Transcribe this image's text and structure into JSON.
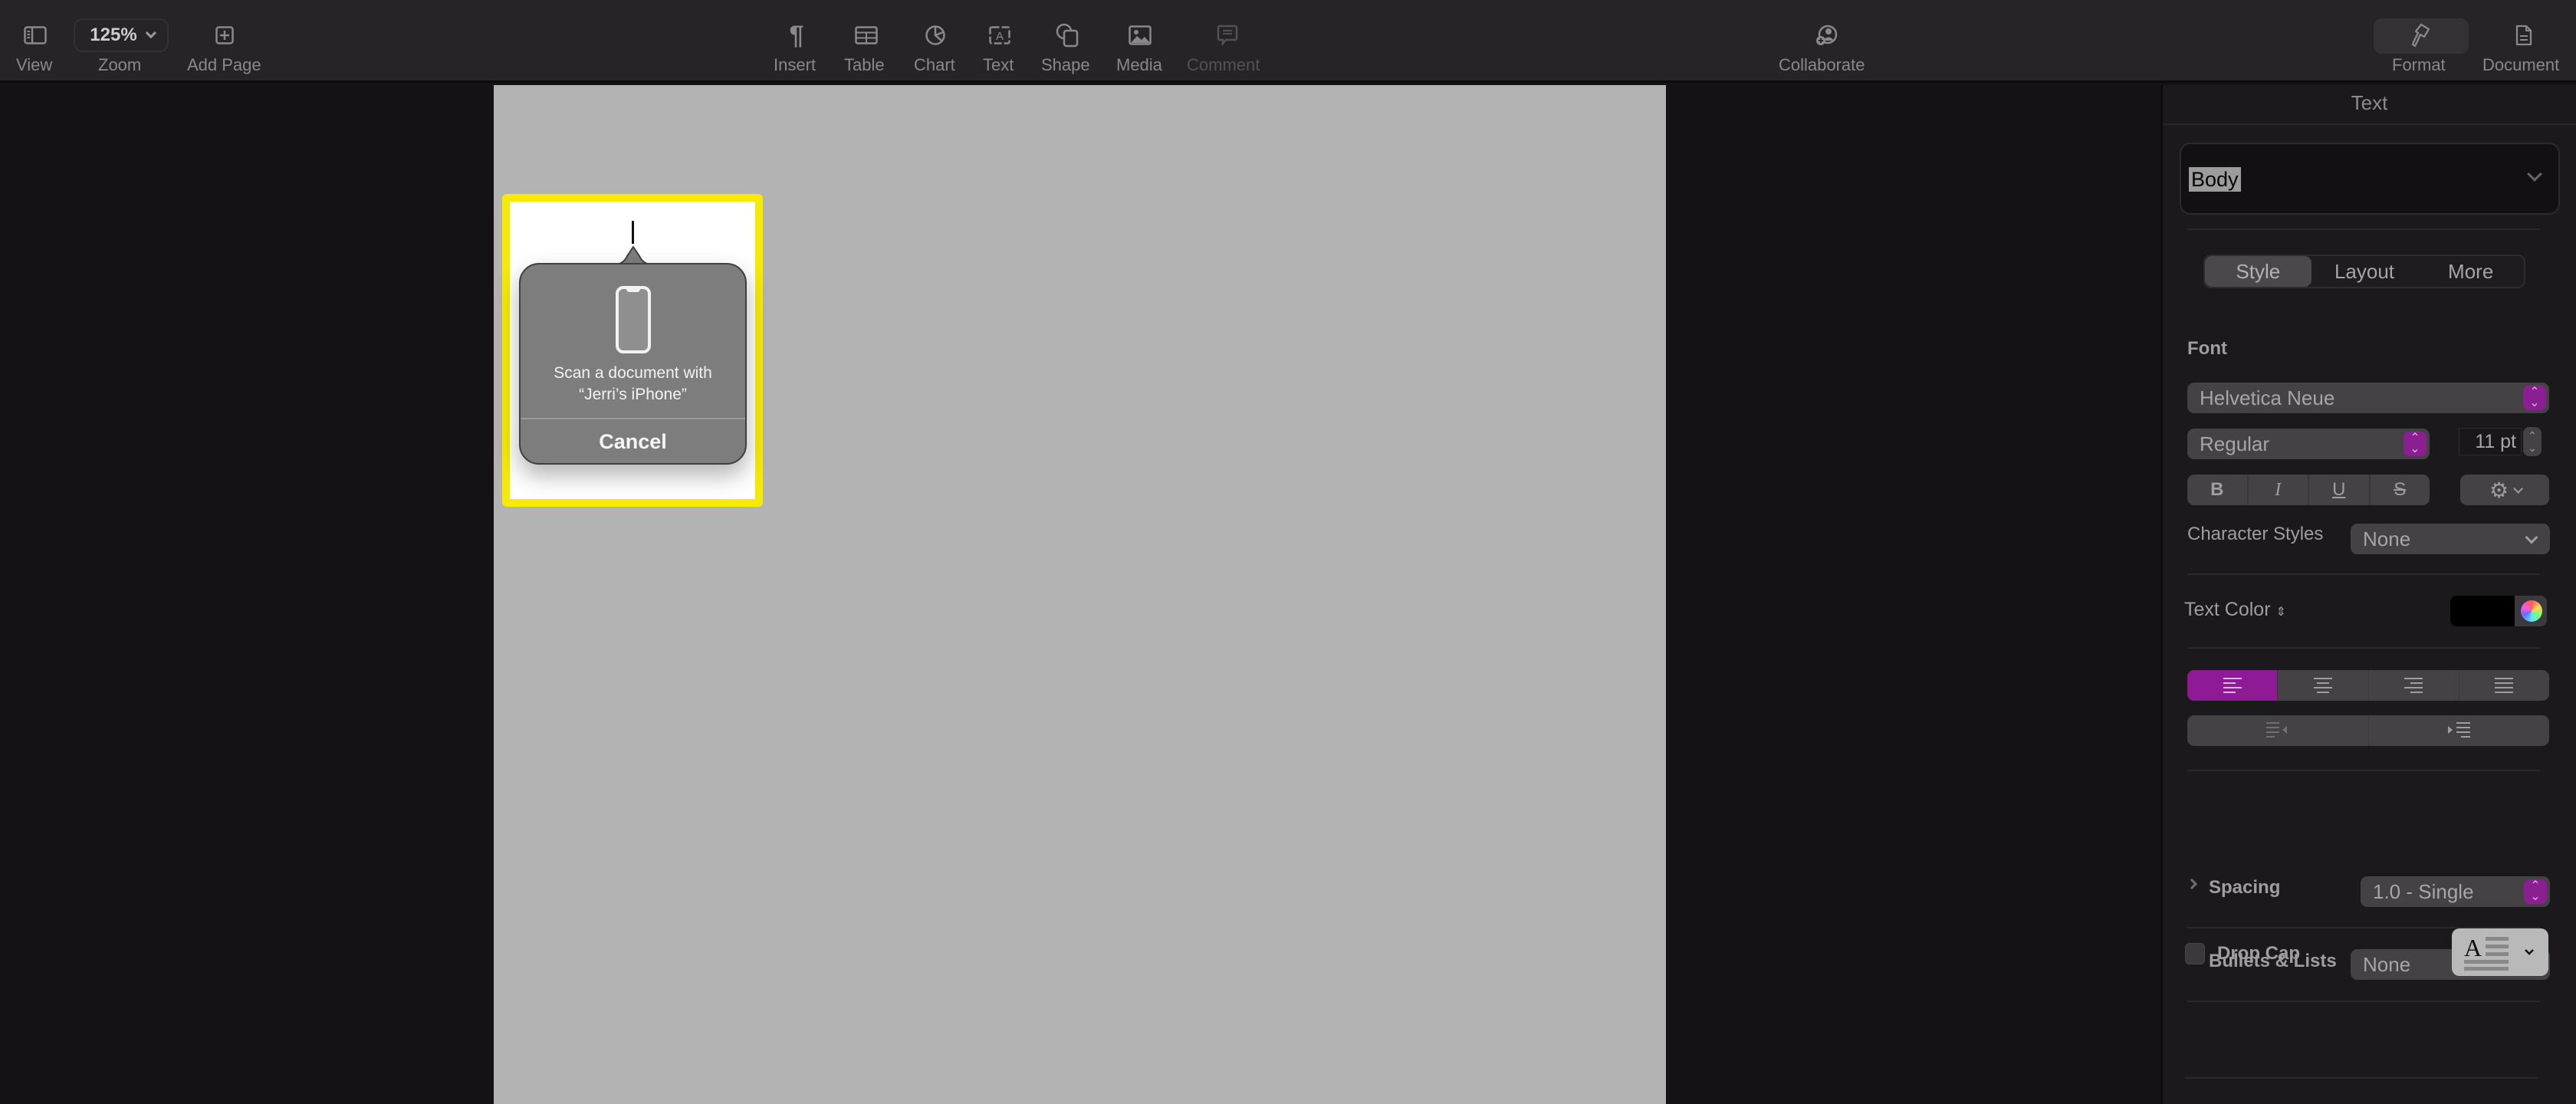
{
  "toolbar": {
    "left": [
      {
        "id": "view",
        "label": "View",
        "icon": "sidebar-icon"
      },
      {
        "id": "zoom",
        "label": "Zoom",
        "value": "125%"
      },
      {
        "id": "add-page",
        "label": "Add Page",
        "icon": "add-page-icon"
      }
    ],
    "center": [
      {
        "id": "insert",
        "label": "Insert",
        "icon": "pilcrow-icon"
      },
      {
        "id": "table",
        "label": "Table",
        "icon": "table-icon"
      },
      {
        "id": "chart",
        "label": "Chart",
        "icon": "chart-icon"
      },
      {
        "id": "text",
        "label": "Text",
        "icon": "text-box-icon"
      },
      {
        "id": "shape",
        "label": "Shape",
        "icon": "shape-icon"
      },
      {
        "id": "media",
        "label": "Media",
        "icon": "media-icon"
      },
      {
        "id": "comment",
        "label": "Comment",
        "icon": "comment-icon",
        "disabled": true
      }
    ],
    "collaborate": {
      "label": "Collaborate",
      "icon": "collaborate-icon"
    },
    "right": [
      {
        "id": "format",
        "label": "Format",
        "icon": "paintbrush-icon",
        "active": true
      },
      {
        "id": "document",
        "label": "Document",
        "icon": "document-icon"
      }
    ]
  },
  "popover": {
    "message_line1": "Scan a document with",
    "message_line2": "“Jerri’s iPhone”",
    "cancel_label": "Cancel",
    "icon": "iphone-icon"
  },
  "highlight_color": "#f6ea00",
  "panel": {
    "title": "Text",
    "paragraph_style": "Body",
    "tabs": [
      {
        "label": "Style",
        "active": true
      },
      {
        "label": "Layout",
        "active": false
      },
      {
        "label": "More",
        "active": false
      }
    ],
    "font": {
      "section_label": "Font",
      "family": "Helvetica Neue",
      "typeface": "Regular",
      "size": "11 pt",
      "bold": "B",
      "italic": "I",
      "underline": "U",
      "strike": "S"
    },
    "character_styles": {
      "label": "Character Styles",
      "value": "None"
    },
    "text_color": {
      "label": "Text Color",
      "value": "#000000"
    },
    "alignment": {
      "options": [
        "left",
        "center",
        "right",
        "justify"
      ],
      "selected": "left"
    },
    "spacing": {
      "label": "Spacing",
      "value": "1.0 - Single"
    },
    "bullets": {
      "label": "Bullets & Lists",
      "value": "None"
    },
    "drop_cap": {
      "label": "Drop Cap",
      "checked": false
    },
    "accent_color": "#8e1b95"
  }
}
